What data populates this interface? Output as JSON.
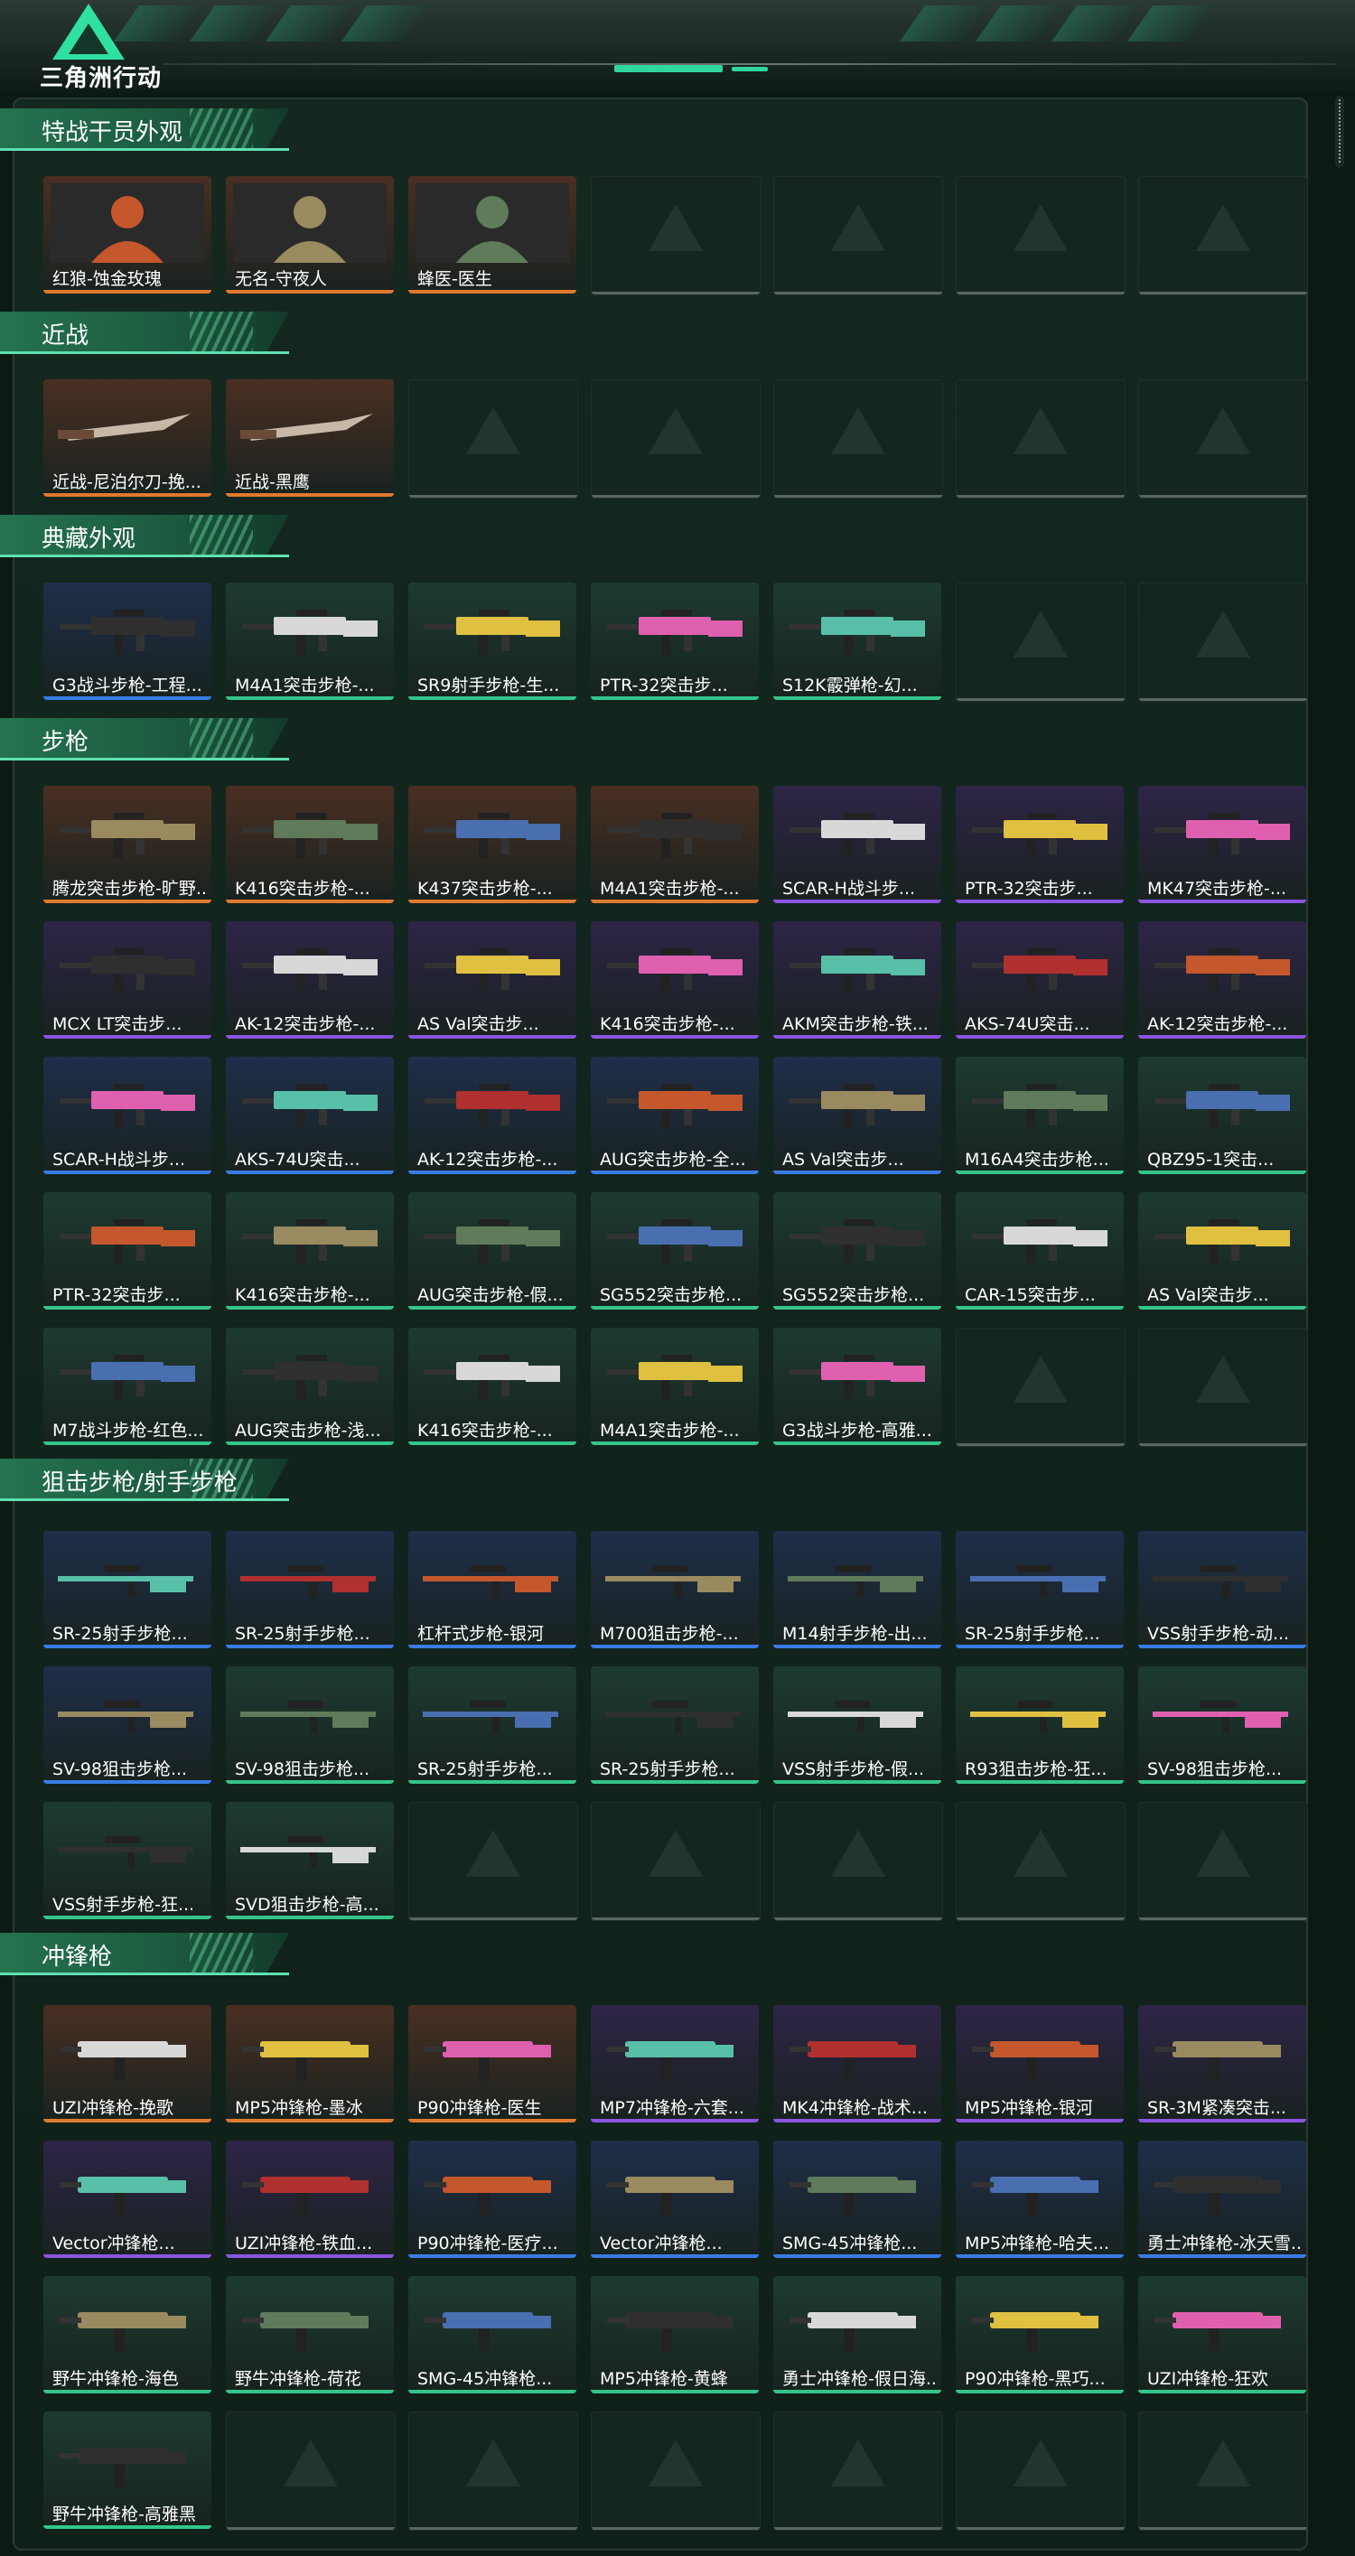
{
  "app": {
    "logo_text": "三角洲行动"
  },
  "colors": {
    "orange": {
      "bg": "#4a2f22",
      "bar": "#e07a2e"
    },
    "purple": {
      "bg": "#2e2447",
      "bar": "#8a55e0"
    },
    "blue": {
      "bg": "#1f2e4a",
      "bar": "#3a7ce6"
    },
    "green": {
      "bg": "#1d3b31",
      "bar": "#34c58a"
    }
  },
  "sections": [
    {
      "title": "特战干员外观",
      "rows": [
        [
          {
            "label": "红狼-蚀金玫瑰",
            "rarity": "orange",
            "icon": "operator-portrait-icon"
          },
          {
            "label": "无名-守夜人",
            "rarity": "orange",
            "icon": "operator-portrait-icon"
          },
          {
            "label": "蜂医-医生",
            "rarity": "orange",
            "icon": "operator-portrait-icon"
          },
          null,
          null,
          null,
          null
        ]
      ]
    },
    {
      "title": "近战",
      "rows": [
        [
          {
            "label": "近战-尼泊尔刀-挽...",
            "rarity": "orange",
            "icon": "knife-icon"
          },
          {
            "label": "近战-黑鹰",
            "rarity": "orange",
            "icon": "knife-icon"
          },
          null,
          null,
          null,
          null,
          null
        ]
      ]
    },
    {
      "title": "典藏外观",
      "rows": [
        [
          {
            "label": "G3战斗步枪-工程...",
            "rarity": "blue",
            "icon": "rifle-icon"
          },
          {
            "label": "M4A1突击步枪-...",
            "rarity": "green",
            "icon": "rifle-icon"
          },
          {
            "label": "SR9射手步枪-生...",
            "rarity": "green",
            "icon": "rifle-icon"
          },
          {
            "label": "PTR-32突击步...",
            "rarity": "green",
            "icon": "rifle-icon"
          },
          {
            "label": "S12K霰弹枪-幻...",
            "rarity": "green",
            "icon": "shotgun-icon"
          },
          null,
          null
        ]
      ]
    },
    {
      "title": "步枪",
      "rows": [
        [
          {
            "label": "腾龙突击步枪-旷野...",
            "rarity": "orange",
            "icon": "rifle-icon"
          },
          {
            "label": "K416突击步枪-...",
            "rarity": "orange",
            "icon": "rifle-icon"
          },
          {
            "label": "K437突击步枪-...",
            "rarity": "orange",
            "icon": "rifle-icon"
          },
          {
            "label": "M4A1突击步枪-...",
            "rarity": "orange",
            "icon": "rifle-icon"
          },
          {
            "label": "SCAR-H战斗步...",
            "rarity": "purple",
            "icon": "rifle-icon"
          },
          {
            "label": "PTR-32突击步...",
            "rarity": "purple",
            "icon": "rifle-icon"
          },
          {
            "label": "MK47突击步枪-...",
            "rarity": "purple",
            "icon": "rifle-icon"
          }
        ],
        [
          {
            "label": "MCX LT突击步...",
            "rarity": "purple",
            "icon": "rifle-icon"
          },
          {
            "label": "AK-12突击步枪-...",
            "rarity": "purple",
            "icon": "rifle-icon"
          },
          {
            "label": "AS Val突击步...",
            "rarity": "purple",
            "icon": "rifle-icon"
          },
          {
            "label": "K416突击步枪-...",
            "rarity": "purple",
            "icon": "rifle-icon"
          },
          {
            "label": "AKM突击步枪-铁...",
            "rarity": "purple",
            "icon": "rifle-icon"
          },
          {
            "label": "AKS-74U突击...",
            "rarity": "purple",
            "icon": "rifle-icon"
          },
          {
            "label": "AK-12突击步枪-...",
            "rarity": "purple",
            "icon": "rifle-icon"
          }
        ],
        [
          {
            "label": "SCAR-H战斗步...",
            "rarity": "blue",
            "icon": "rifle-icon"
          },
          {
            "label": "AKS-74U突击...",
            "rarity": "blue",
            "icon": "rifle-icon"
          },
          {
            "label": "AK-12突击步枪-...",
            "rarity": "blue",
            "icon": "rifle-icon"
          },
          {
            "label": "AUG突击步枪-全...",
            "rarity": "blue",
            "icon": "rifle-icon"
          },
          {
            "label": "AS Val突击步...",
            "rarity": "blue",
            "icon": "rifle-icon"
          },
          {
            "label": "M16A4突击步枪...",
            "rarity": "green",
            "icon": "rifle-icon"
          },
          {
            "label": "QBZ95-1突击...",
            "rarity": "green",
            "icon": "rifle-icon"
          }
        ],
        [
          {
            "label": "PTR-32突击步...",
            "rarity": "green",
            "icon": "rifle-icon"
          },
          {
            "label": "K416突击步枪-...",
            "rarity": "green",
            "icon": "rifle-icon"
          },
          {
            "label": "AUG突击步枪-假...",
            "rarity": "green",
            "icon": "rifle-icon"
          },
          {
            "label": "SG552突击步枪...",
            "rarity": "green",
            "icon": "rifle-icon"
          },
          {
            "label": "SG552突击步枪...",
            "rarity": "green",
            "icon": "rifle-icon"
          },
          {
            "label": "CAR-15突击步...",
            "rarity": "green",
            "icon": "rifle-icon"
          },
          {
            "label": "AS Val突击步...",
            "rarity": "green",
            "icon": "rifle-icon"
          }
        ],
        [
          {
            "label": "M7战斗步枪-红色...",
            "rarity": "green",
            "icon": "rifle-icon"
          },
          {
            "label": "AUG突击步枪-浅...",
            "rarity": "green",
            "icon": "rifle-icon"
          },
          {
            "label": "K416突击步枪-...",
            "rarity": "green",
            "icon": "rifle-icon"
          },
          {
            "label": "M4A1突击步枪-...",
            "rarity": "green",
            "icon": "rifle-icon"
          },
          {
            "label": "G3战斗步枪-高雅...",
            "rarity": "green",
            "icon": "rifle-icon"
          },
          null,
          null
        ]
      ]
    },
    {
      "title": "狙击步枪/射手步枪",
      "rows": [
        [
          {
            "label": "SR-25射手步枪...",
            "rarity": "blue",
            "icon": "sniper-icon"
          },
          {
            "label": "SR-25射手步枪...",
            "rarity": "blue",
            "icon": "sniper-icon"
          },
          {
            "label": "杠杆式步枪-银河",
            "rarity": "blue",
            "icon": "sniper-icon"
          },
          {
            "label": "M700狙击步枪-...",
            "rarity": "blue",
            "icon": "sniper-icon"
          },
          {
            "label": "M14射手步枪-出...",
            "rarity": "blue",
            "icon": "sniper-icon"
          },
          {
            "label": "SR-25射手步枪...",
            "rarity": "blue",
            "icon": "sniper-icon"
          },
          {
            "label": "VSS射手步枪-动...",
            "rarity": "blue",
            "icon": "sniper-icon"
          }
        ],
        [
          {
            "label": "SV-98狙击步枪...",
            "rarity": "blue",
            "icon": "sniper-icon"
          },
          {
            "label": "SV-98狙击步枪...",
            "rarity": "green",
            "icon": "sniper-icon"
          },
          {
            "label": "SR-25射手步枪...",
            "rarity": "green",
            "icon": "sniper-icon"
          },
          {
            "label": "SR-25射手步枪...",
            "rarity": "green",
            "icon": "sniper-icon"
          },
          {
            "label": "VSS射手步枪-假...",
            "rarity": "green",
            "icon": "sniper-icon"
          },
          {
            "label": "R93狙击步枪-狂...",
            "rarity": "green",
            "icon": "sniper-icon"
          },
          {
            "label": "SV-98狙击步枪...",
            "rarity": "green",
            "icon": "sniper-icon"
          }
        ],
        [
          {
            "label": "VSS射手步枪-狂...",
            "rarity": "green",
            "icon": "sniper-icon"
          },
          {
            "label": "SVD狙击步枪-高...",
            "rarity": "green",
            "icon": "sniper-icon"
          },
          null,
          null,
          null,
          null,
          null
        ]
      ]
    },
    {
      "title": "冲锋枪",
      "rows": [
        [
          {
            "label": "UZI冲锋枪-挽歌",
            "rarity": "orange",
            "icon": "smg-icon"
          },
          {
            "label": "MP5冲锋枪-墨冰",
            "rarity": "orange",
            "icon": "smg-icon"
          },
          {
            "label": "P90冲锋枪-医生",
            "rarity": "orange",
            "icon": "smg-icon"
          },
          {
            "label": "MP7冲锋枪-六套...",
            "rarity": "purple",
            "icon": "smg-icon"
          },
          {
            "label": "MK4冲锋枪-战术...",
            "rarity": "purple",
            "icon": "smg-icon"
          },
          {
            "label": "MP5冲锋枪-银河",
            "rarity": "purple",
            "icon": "smg-icon"
          },
          {
            "label": "SR-3M紧凑突击...",
            "rarity": "purple",
            "icon": "smg-icon"
          }
        ],
        [
          {
            "label": "Vector冲锋枪...",
            "rarity": "purple",
            "icon": "smg-icon"
          },
          {
            "label": "UZI冲锋枪-铁血...",
            "rarity": "purple",
            "icon": "smg-icon"
          },
          {
            "label": "P90冲锋枪-医疗...",
            "rarity": "blue",
            "icon": "smg-icon"
          },
          {
            "label": "Vector冲锋枪...",
            "rarity": "blue",
            "icon": "smg-icon"
          },
          {
            "label": "SMG-45冲锋枪...",
            "rarity": "blue",
            "icon": "smg-icon"
          },
          {
            "label": "MP5冲锋枪-哈夫...",
            "rarity": "blue",
            "icon": "smg-icon"
          },
          {
            "label": "勇士冲锋枪-冰天雪...",
            "rarity": "blue",
            "icon": "smg-icon"
          }
        ],
        [
          {
            "label": "野牛冲锋枪-海色",
            "rarity": "green",
            "icon": "smg-icon"
          },
          {
            "label": "野牛冲锋枪-荷花",
            "rarity": "green",
            "icon": "smg-icon"
          },
          {
            "label": "SMG-45冲锋枪...",
            "rarity": "green",
            "icon": "smg-icon"
          },
          {
            "label": "MP5冲锋枪-黄蜂",
            "rarity": "green",
            "icon": "smg-icon"
          },
          {
            "label": "勇士冲锋枪-假日海...",
            "rarity": "green",
            "icon": "smg-icon"
          },
          {
            "label": "P90冲锋枪-黑巧...",
            "rarity": "green",
            "icon": "smg-icon"
          },
          {
            "label": "UZI冲锋枪-狂欢",
            "rarity": "green",
            "icon": "smg-icon"
          }
        ],
        [
          {
            "label": "野牛冲锋枪-高雅黑",
            "rarity": "green",
            "icon": "smg-icon"
          },
          null,
          null,
          null,
          null,
          null,
          null
        ]
      ]
    }
  ]
}
